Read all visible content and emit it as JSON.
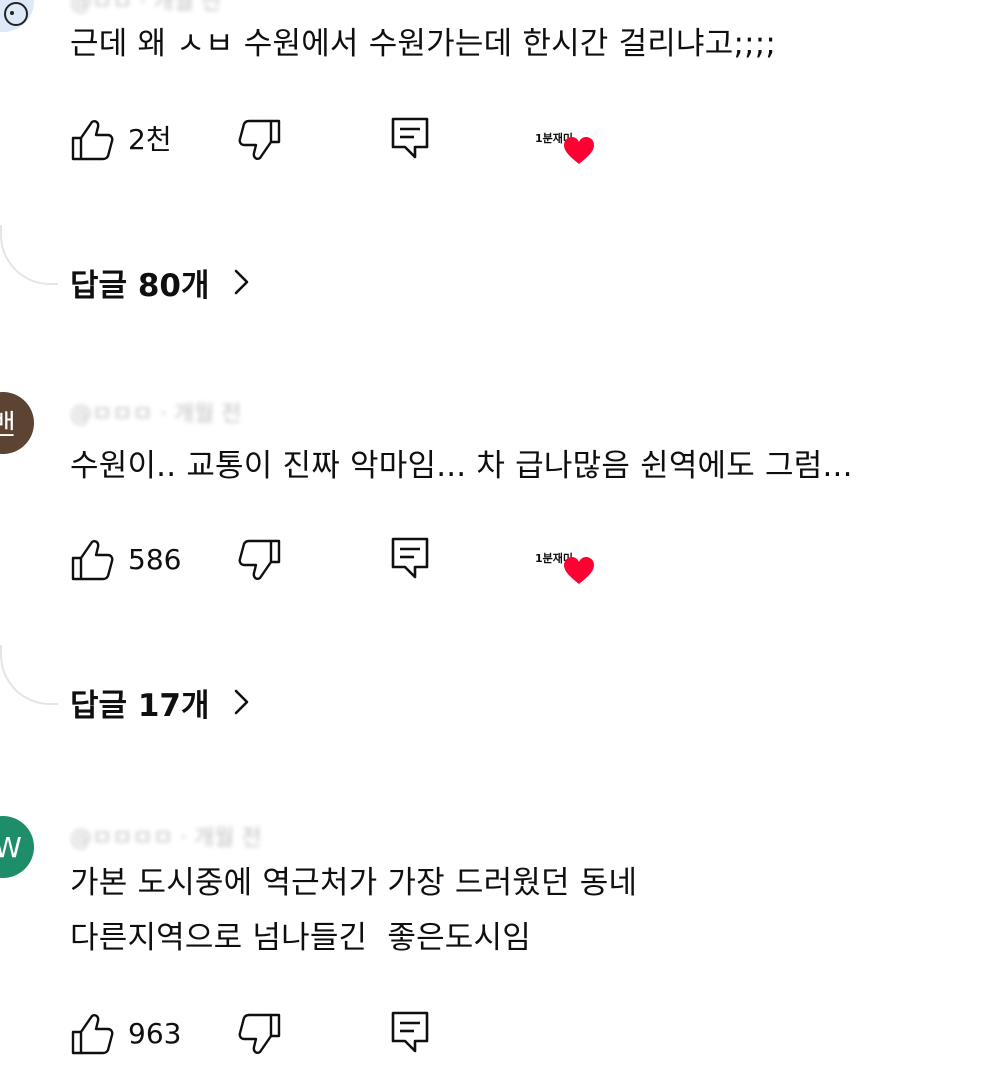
{
  "comments": [
    {
      "avatar_initial": "",
      "avatar_color": "#dde9f7",
      "meta": "@ㅁㅁ ·  개월 전",
      "lines": [
        "근데 왜 ㅅㅂ 수원에서 수원가는데 한시간 걸리냐고;;;;"
      ],
      "likes": "2천",
      "badge": "1분재미",
      "replies": "답글 80개"
    },
    {
      "avatar_initial": "밴",
      "avatar_color": "#5c4332",
      "meta": "@ㅁㅁㅁ · 개월 전",
      "lines": [
        "수원이.. 교통이 진짜 악마임... 차 급나많음 쉰역에도 그럼..."
      ],
      "likes": "586",
      "badge": "1분재미",
      "replies": "답글 17개"
    },
    {
      "avatar_initial": "W",
      "avatar_color": "#1e8e6a",
      "meta": "@ㅁㅁㅁㅁ · 개월 전",
      "lines": [
        "가본 도시중에 역근처가 가장 드러웠던 동네",
        "다른지역으로 넘나들긴  좋은도시임"
      ],
      "likes": "963"
    }
  ],
  "icons": {
    "like": "thumb-up-icon",
    "dislike": "thumb-down-icon",
    "reply": "comment-icon",
    "heart": "heart-icon",
    "chevron": "chevron-right-icon"
  },
  "colors": {
    "heart": "#ff0033",
    "text": "#0f0f0f",
    "meta": "#909090"
  }
}
